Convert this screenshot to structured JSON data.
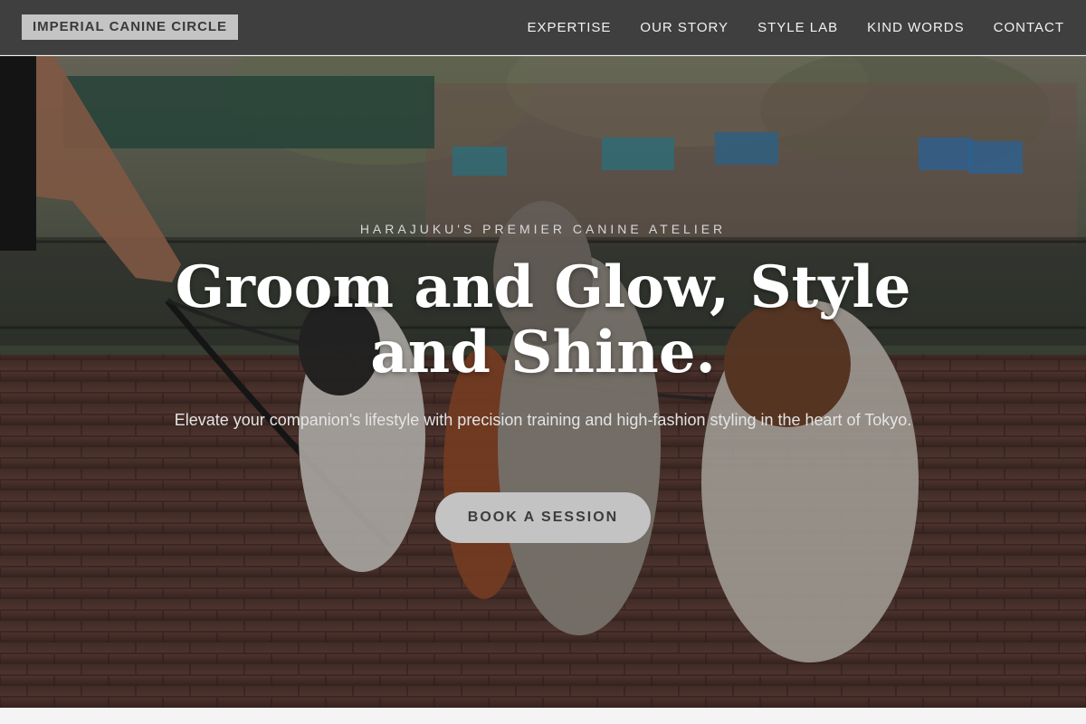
{
  "nav": {
    "brand": "IMPERIAL CANINE CIRCLE",
    "links": [
      "EXPERTISE",
      "OUR STORY",
      "STYLE LAB",
      "KIND WORDS",
      "CONTACT"
    ]
  },
  "hero": {
    "eyebrow": "HARAJUKU'S PREMIER CANINE ATELIER",
    "headline_line1": "Groom and Glow, Style",
    "headline_line2": "and Shine.",
    "subtext": "Elevate your companion's lifestyle with precision training and high-fashion styling in the heart of Tokyo.",
    "cta_label": "BOOK A SESSION"
  },
  "colors": {
    "navbar_bg": "#3f3f3f",
    "brand_bg": "#c4c4c4",
    "cta_bg": "#c3c3c3",
    "headline": "#ffffff"
  }
}
